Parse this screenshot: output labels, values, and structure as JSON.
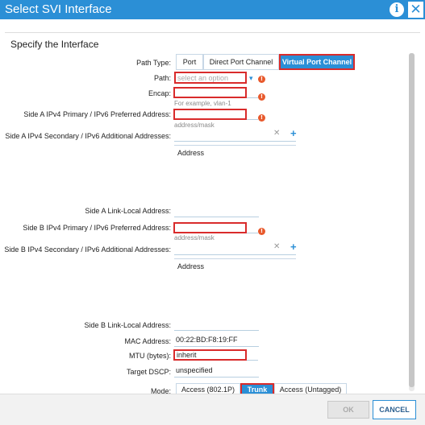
{
  "dialog": {
    "title": "Select SVI Interface"
  },
  "section_heading": "Specify the Interface",
  "path_type": {
    "label": "Path Type:",
    "options": [
      "Port",
      "Direct Port Channel",
      "Virtual Port Channel"
    ],
    "selected": "Virtual Port Channel"
  },
  "path": {
    "label": "Path:",
    "placeholder": "select an option"
  },
  "encap": {
    "label": "Encap:",
    "hint": "For example, vlan-1"
  },
  "side_a_primary": {
    "label": "Side A IPv4 Primary / IPv6 Preferred Address:",
    "hint": "address/mask"
  },
  "side_a_secondary": {
    "label": "Side A IPv4 Secondary / IPv6 Additional Addresses:",
    "column": "Address"
  },
  "side_a_link_local": {
    "label": "Side A Link-Local Address:"
  },
  "side_b_primary": {
    "label": "Side B IPv4 Primary / IPv6 Preferred Address:",
    "hint": "address/mask"
  },
  "side_b_secondary": {
    "label": "Side B IPv4 Secondary / IPv6 Additional Addresses:",
    "column": "Address"
  },
  "side_b_link_local": {
    "label": "Side B Link-Local Address:"
  },
  "mac": {
    "label": "MAC Address:",
    "value": "00:22:BD:F8:19:FF"
  },
  "mtu": {
    "label": "MTU (bytes):",
    "value": "inherit"
  },
  "dscp": {
    "label": "Target DSCP:",
    "value": "unspecified"
  },
  "mode": {
    "label": "Mode:",
    "options": [
      "Access (802.1P)",
      "Trunk",
      "Access (Untagged)"
    ],
    "selected": "Trunk"
  },
  "footer": {
    "ok_label": "OK",
    "cancel_label": "CANCEL"
  },
  "warn_glyph": "!",
  "icons": {
    "info": "info-icon",
    "close": "close-icon",
    "remove": "remove-icon",
    "add": "add-icon"
  }
}
